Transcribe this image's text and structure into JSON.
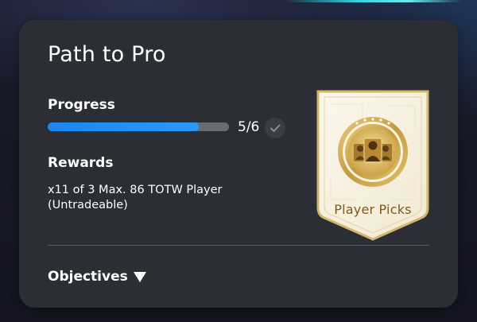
{
  "objective": {
    "title": "Path to Pro",
    "progress_label": "Progress",
    "progress_current": 5,
    "progress_total": 6,
    "progress_fraction": 0.833,
    "progress_text": "5/6",
    "rewards_label": "Rewards",
    "reward_text": "x11 of 3 Max. 86 TOTW Player (Untradeable)",
    "objectives_toggle_label": "Objectives",
    "objectives_toggle_icon": "caret-down-icon"
  },
  "reward_pack": {
    "label": "Player Picks",
    "icon": "player-group-icon"
  },
  "colors": {
    "card_background": "#2c2e36",
    "progress_fill": "#2b97ff",
    "progress_track": "#6a6c73",
    "pack_gold": "#c9a24a",
    "pack_label": "#7a5a1d"
  }
}
